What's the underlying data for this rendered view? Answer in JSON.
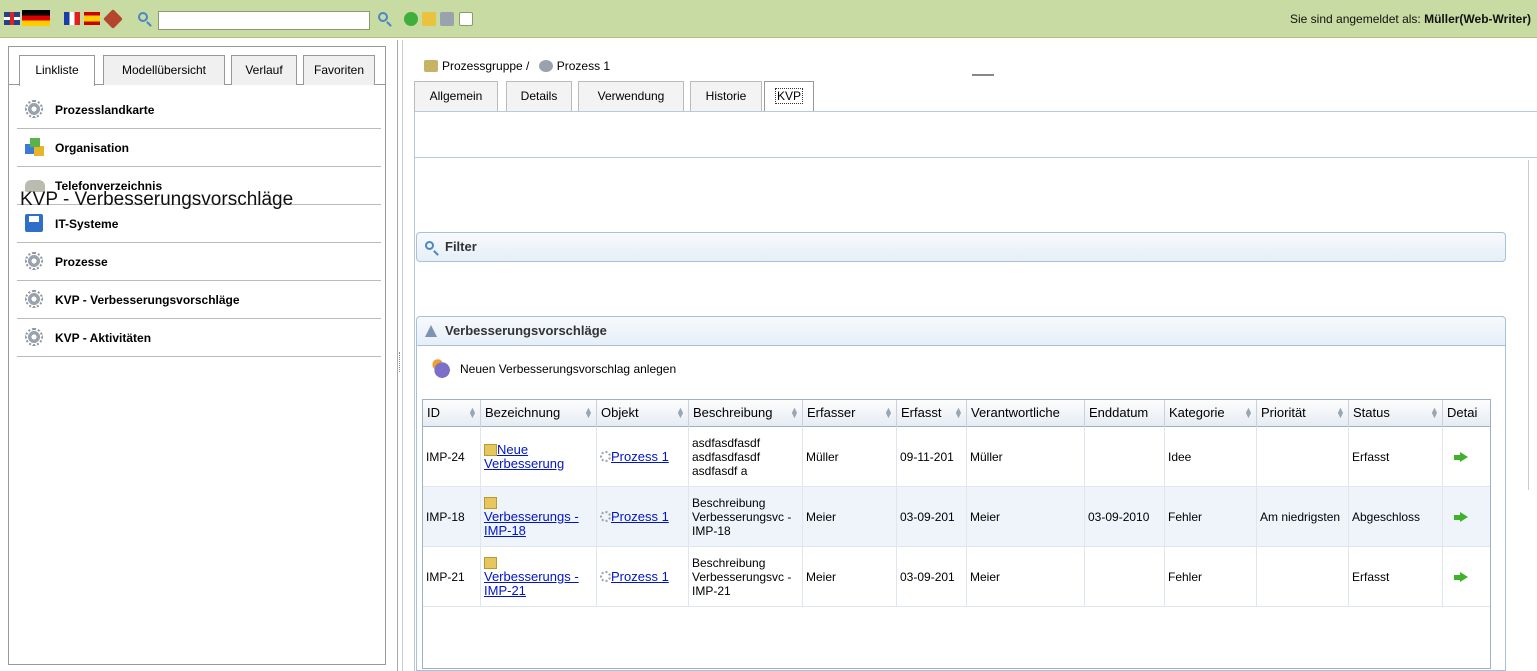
{
  "topbar": {
    "search_value": "",
    "login_prefix": "Sie sind angemeldet als: ",
    "login_user": "Müller(Web-Writer)"
  },
  "sidebar": {
    "tabs": [
      "Linkliste",
      "Modellübersicht",
      "Verlauf",
      "Favoriten"
    ],
    "active_tab": "Linkliste",
    "items": [
      {
        "label": "Prozesslandkarte",
        "icon": "gear-magnifier-icon"
      },
      {
        "label": "Organisation",
        "icon": "org-cubes-icon"
      },
      {
        "label": "Telefonverzeichnis",
        "icon": "phone-icon"
      },
      {
        "label": "IT-Systeme",
        "icon": "floppy-disk-icon"
      },
      {
        "label": "Prozesse",
        "icon": "gears-icon"
      },
      {
        "label": "KVP - Verbesserungsvorschläge",
        "icon": "gears-icon"
      },
      {
        "label": "KVP - Aktivitäten",
        "icon": "gears-icon"
      }
    ]
  },
  "breadcrumb": {
    "group": "Prozessgruppe /",
    "process": "Prozess 1"
  },
  "content_tabs": [
    "Allgemein",
    "Details",
    "Verwendung",
    "Historie",
    "KVP"
  ],
  "active_content_tab": "KVP",
  "page_title": "KVP - Verbesserungsvorschläge",
  "filter_title": "Filter",
  "proposals_title": "Verbesserungsvorschläge",
  "new_proposal_label": "Neuen Verbesserungsvorschlag anlegen",
  "grid": {
    "columns": [
      "ID",
      "Bezeichnung",
      "Objekt",
      "Beschreibung",
      "Erfasser",
      "Erfasst",
      "Verantwortliche",
      "Enddatum",
      "Kategorie",
      "Priorität",
      "Status",
      "Detai"
    ],
    "rows": [
      {
        "id": "IMP-24",
        "bezeichnung": "Neue Verbesserung",
        "objekt": "Prozess 1",
        "beschreibung": "asdfasdfasdf asdfasdfasdf asdfasdf a",
        "erfasser": "Müller",
        "erfasst": "09-11-201",
        "verantwortlich": "Müller",
        "enddatum": "",
        "kategorie": "Idee",
        "prioritaet": "",
        "status": "Erfasst"
      },
      {
        "id": "IMP-18",
        "bezeichnung": "Verbesserungs - IMP-18",
        "objekt": "Prozess 1",
        "beschreibung": "Beschreibung Verbesserungsvc - IMP-18",
        "erfasser": "Meier",
        "erfasst": "03-09-201",
        "verantwortlich": "Meier",
        "enddatum": "03-09-2010",
        "kategorie": "Fehler",
        "prioritaet": "Am niedrigsten",
        "status": "Abgeschloss"
      },
      {
        "id": "IMP-21",
        "bezeichnung": "Verbesserungs - IMP-21",
        "objekt": "Prozess 1",
        "beschreibung": "Beschreibung Verbesserungsvc - IMP-21",
        "erfasser": "Meier",
        "erfasst": "03-09-201",
        "verantwortlich": "Meier",
        "enddatum": "",
        "kategorie": "Fehler",
        "prioritaet": "",
        "status": "Erfasst"
      }
    ]
  },
  "colors": {
    "topbar": "#c7dba2",
    "link": "#0014c8",
    "alt_row": "#eef4fa",
    "panel_border": "#a9c0d6"
  }
}
